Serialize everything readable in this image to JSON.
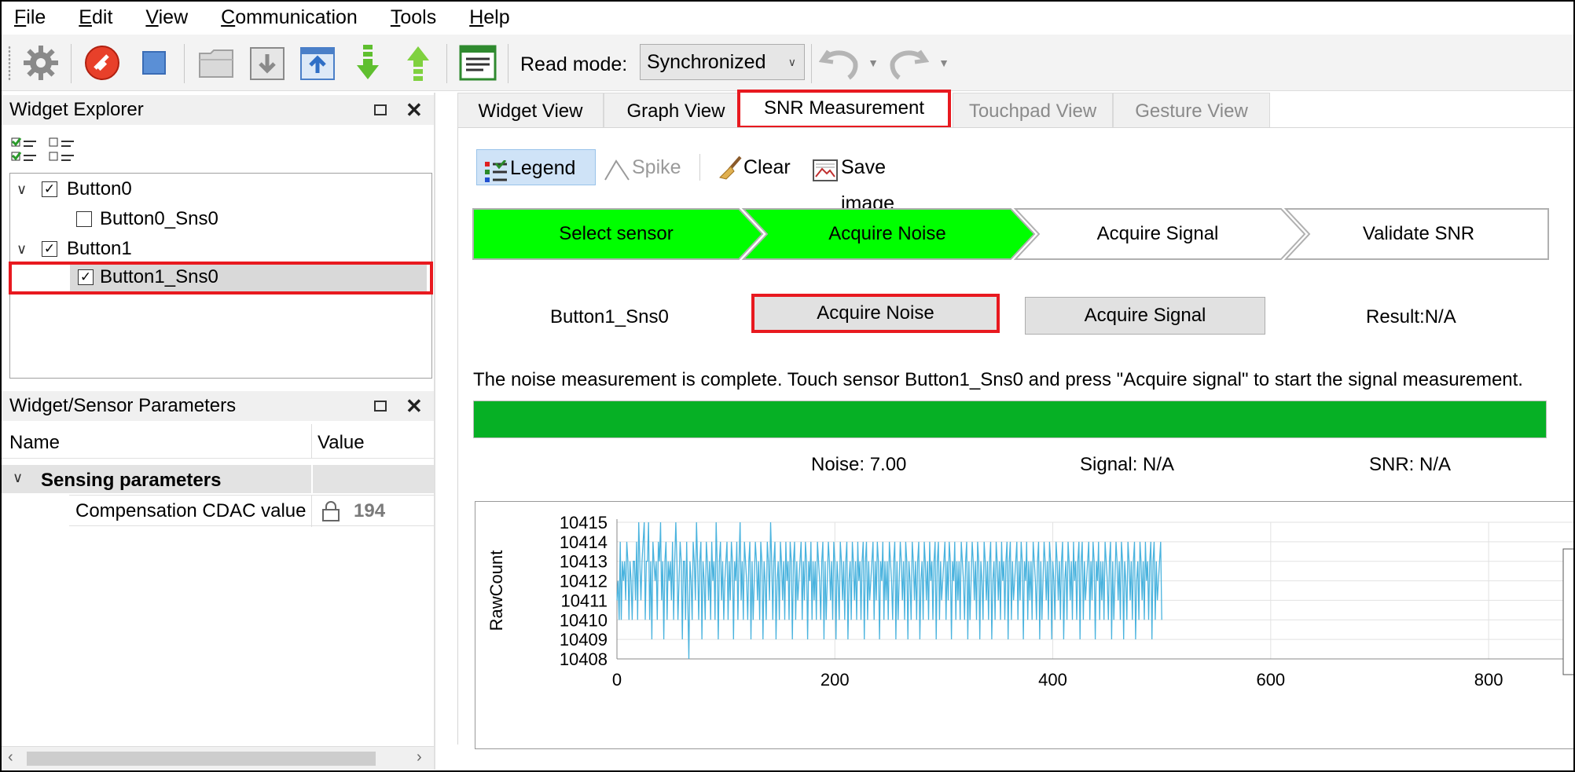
{
  "menu": [
    "File",
    "Edit",
    "View",
    "Communication",
    "Tools",
    "Help"
  ],
  "menu_underline": [
    "F",
    "E",
    "V",
    "C",
    "T",
    "H"
  ],
  "toolbar": {
    "read_mode_label": "Read mode:",
    "read_mode_value": "Synchronized",
    "icons": [
      "gear-icon",
      "disconnect-icon",
      "stop-icon",
      "open-folder-icon",
      "import-icon",
      "export-icon",
      "read-down-icon",
      "write-up-icon",
      "log-icon",
      "undo-icon",
      "redo-icon"
    ]
  },
  "widget_explorer": {
    "title": "Widget Explorer",
    "tree": [
      {
        "label": "Button0",
        "checked": true,
        "expanded": true
      },
      {
        "label": "Button0_Sns0",
        "checked": false
      },
      {
        "label": "Button1",
        "checked": true,
        "expanded": true
      },
      {
        "label": "Button1_Sns0",
        "checked": true,
        "selected": true
      }
    ]
  },
  "params_panel": {
    "title": "Widget/Sensor Parameters",
    "col_name": "Name",
    "col_value": "Value",
    "group": "Sensing parameters",
    "row_name": "Compensation CDAC value",
    "row_value": "194"
  },
  "tabs": [
    {
      "label": "Widget View",
      "state": "normal"
    },
    {
      "label": "Graph View",
      "state": "normal"
    },
    {
      "label": "SNR Measurement",
      "state": "active"
    },
    {
      "label": "Touchpad View",
      "state": "disabled"
    },
    {
      "label": "Gesture View",
      "state": "disabled"
    }
  ],
  "snr_toolbar": {
    "legend": "Legend",
    "spike": "Spike",
    "clear": "Clear",
    "save_image": "Save image"
  },
  "steps": [
    {
      "label": "Select sensor",
      "done": true
    },
    {
      "label": "Acquire Noise",
      "done": true
    },
    {
      "label": "Acquire Signal",
      "done": false
    },
    {
      "label": "Validate SNR",
      "done": false
    }
  ],
  "measurement": {
    "sensor": "Button1_Sns0",
    "acquire_noise": "Acquire Noise",
    "acquire_signal": "Acquire Signal",
    "result": "Result:N/A",
    "message": "The noise measurement is complete. Touch sensor Button1_Sns0 and press \"Acquire signal\" to start the signal measurement.",
    "progress": 1.0,
    "noise": "Noise:  7.00",
    "signal": "Signal:  N/A",
    "snr": "SNR:  N/A"
  },
  "colors": {
    "step_done": "#00ff00",
    "progress": "#06b025",
    "highlight": "#e8191f",
    "series": "#4ab3de"
  },
  "chart_data": {
    "type": "line",
    "ylabel": "RawCount",
    "xlabel": "",
    "xlim": [
      0,
      880
    ],
    "ylim": [
      10408,
      10415
    ],
    "xticks": [
      "0",
      "200",
      "400",
      "600",
      "800"
    ],
    "yticks": [
      "10415",
      "10414",
      "10413",
      "10412",
      "10411",
      "10410",
      "10409",
      "10408"
    ],
    "series": [
      {
        "x_start": 0,
        "x_end": 500,
        "values": [
          10411,
          10412,
          10410,
          10414,
          10410,
          10413,
          10412,
          10413,
          10411,
          10414,
          10413,
          10410,
          10413,
          10412,
          10410,
          10413,
          10413,
          10411,
          10414,
          10410,
          10415,
          10413,
          10411,
          10413,
          10414,
          10415,
          10410,
          10413,
          10413,
          10415,
          10410,
          10413,
          10409,
          10414,
          10413,
          10412,
          10413,
          10410,
          10414,
          10413,
          10415,
          10411,
          10413,
          10409,
          10413,
          10414,
          10410,
          10413,
          10412,
          10413,
          10411,
          10414,
          10410,
          10413,
          10415,
          10413,
          10410,
          10412,
          10414,
          10413,
          10409,
          10413,
          10413,
          10410,
          10414,
          10411,
          10408,
          10413,
          10412,
          10410,
          10414,
          10413,
          10411,
          10415,
          10413,
          10410,
          10413,
          10414,
          10409,
          10413,
          10412,
          10410,
          10414,
          10413,
          10411,
          10413,
          10410,
          10414,
          10412,
          10413,
          10410,
          10415,
          10413,
          10409,
          10413,
          10414,
          10411,
          10413,
          10410,
          10412,
          10413,
          10414,
          10410,
          10413,
          10411,
          10414,
          10413,
          10409,
          10413,
          10412,
          10414,
          10410,
          10413,
          10415,
          10411,
          10413,
          10410,
          10414,
          10413,
          10412,
          10410,
          10413,
          10414,
          10409,
          10413,
          10410,
          10412,
          10414,
          10413,
          10411,
          10413,
          10410,
          10414,
          10413,
          10409,
          10413,
          10412,
          10410,
          10414,
          10413,
          10411,
          10415,
          10413,
          10410,
          10413,
          10414,
          10409,
          10412,
          10413,
          10410,
          10414,
          10413,
          10411,
          10413,
          10410,
          10414,
          10412,
          10413,
          10410,
          10414,
          10413,
          10409,
          10413,
          10414,
          10410,
          10413,
          10411,
          10412,
          10413,
          10414,
          10410,
          10413,
          10411,
          10414,
          10413,
          10409,
          10413,
          10412,
          10414,
          10410,
          10413,
          10411,
          10413,
          10410,
          10414,
          10413,
          10412,
          10410,
          10413,
          10414,
          10409,
          10413,
          10410,
          10412,
          10414,
          10413,
          10411,
          10413,
          10410,
          10414,
          10413,
          10409,
          10413,
          10412,
          10410,
          10414,
          10413,
          10411,
          10413,
          10410,
          10413,
          10414,
          10409,
          10412,
          10413,
          10410,
          10414,
          10413,
          10411,
          10413,
          10410,
          10414,
          10412,
          10413,
          10410,
          10413,
          10414,
          10409,
          10413,
          10414,
          10410,
          10413,
          10411,
          10412,
          10413,
          10414,
          10410,
          10413,
          10411,
          10414,
          10413,
          10409,
          10413,
          10412,
          10414,
          10410,
          10413,
          10411,
          10413,
          10410,
          10414,
          10413,
          10412,
          10410,
          10413,
          10414,
          10409,
          10413,
          10410,
          10412,
          10414,
          10413,
          10411,
          10413,
          10410,
          10414,
          10413,
          10409,
          10413,
          10412,
          10410,
          10414,
          10413,
          10411,
          10413,
          10410,
          10413,
          10414,
          10409,
          10412,
          10413,
          10410,
          10414,
          10413,
          10411,
          10413,
          10410,
          10414,
          10412,
          10413,
          10410,
          10413,
          10414,
          10409,
          10413,
          10414,
          10410,
          10413,
          10411,
          10412,
          10413,
          10414,
          10410,
          10413,
          10411,
          10414,
          10413,
          10409,
          10413,
          10412,
          10414,
          10410,
          10413,
          10411,
          10413,
          10410,
          10414,
          10413,
          10412,
          10410,
          10413,
          10414,
          10409,
          10413,
          10410,
          10412,
          10414,
          10413,
          10411,
          10413,
          10410,
          10414,
          10413,
          10409,
          10413,
          10412,
          10410,
          10414,
          10413,
          10411,
          10413,
          10410,
          10413,
          10414,
          10409,
          10412,
          10413,
          10410,
          10414,
          10413,
          10411,
          10413,
          10410,
          10414,
          10412,
          10413,
          10410,
          10413,
          10414,
          10409,
          10413,
          10414,
          10410,
          10413,
          10411,
          10412,
          10413,
          10414,
          10410,
          10413,
          10411,
          10414,
          10413,
          10409,
          10413,
          10412,
          10414,
          10410,
          10413,
          10411,
          10413,
          10410,
          10414,
          10413,
          10412,
          10410,
          10413,
          10414,
          10409,
          10413,
          10410,
          10412,
          10414,
          10413,
          10411,
          10413,
          10410,
          10414,
          10413,
          10409,
          10413,
          10412,
          10410,
          10414,
          10413,
          10411,
          10413,
          10410,
          10413,
          10414,
          10409,
          10412,
          10413,
          10410,
          10414,
          10413,
          10411,
          10413,
          10410,
          10414,
          10412,
          10413,
          10410,
          10413,
          10414,
          10409,
          10413,
          10414,
          10410,
          10413,
          10411,
          10412,
          10413,
          10414,
          10410,
          10413,
          10411,
          10414,
          10413,
          10409,
          10413,
          10412,
          10414,
          10410,
          10413,
          10411,
          10413,
          10410,
          10414,
          10413,
          10412,
          10410,
          10413,
          10414,
          10409,
          10413,
          10410,
          10412,
          10414,
          10413,
          10411,
          10413,
          10410,
          10414,
          10413,
          10409,
          10413,
          10412,
          10410,
          10414,
          10413,
          10411,
          10413,
          10410,
          10413,
          10414,
          10409,
          10412,
          10413,
          10410,
          10414,
          10413,
          10411,
          10413,
          10410,
          10414,
          10412,
          10413,
          10410,
          10413,
          10414,
          10409,
          10413,
          10414,
          10410,
          10413,
          10411,
          10412,
          10413,
          10414,
          10410
        ]
      }
    ],
    "grid": true
  }
}
